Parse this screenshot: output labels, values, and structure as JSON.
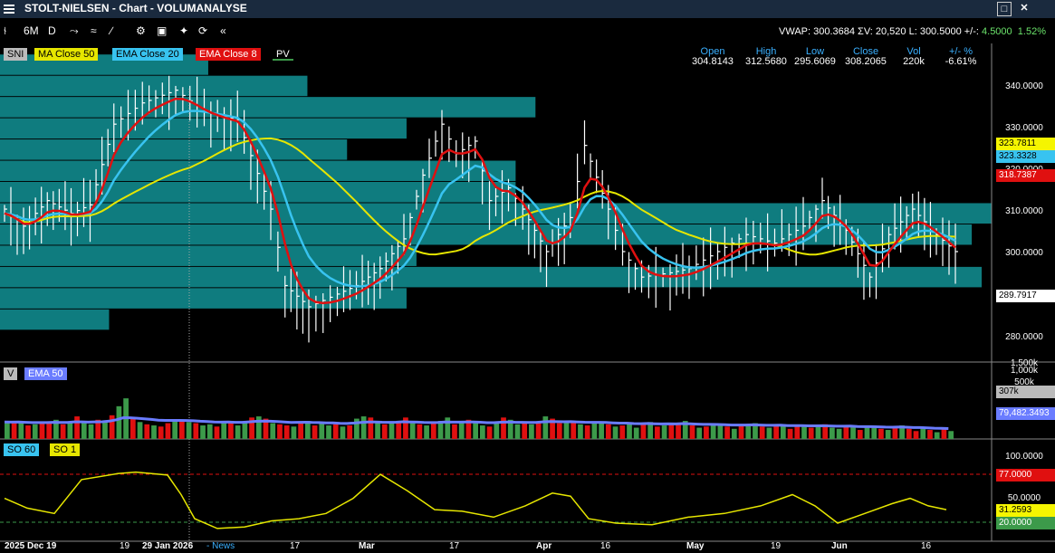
{
  "window": {
    "title": "STOLT-NIELSEN - Chart - VOLUMANALYSE"
  },
  "toolbar": {
    "period": "6M",
    "interval": "D",
    "collapse": "«",
    "vwap_text": "VWAP: 300.3684  ΣV: 20,520  L: 300.5000  +/-: ",
    "change_abs": "4.5000",
    "change_pct": "1.52%"
  },
  "legend": {
    "symbol": "SNI",
    "ma50": "MA Close 50",
    "ema20": "EMA Close 20",
    "ema8": "EMA Close 8",
    "pv": "PV"
  },
  "ohlc": [
    {
      "h": "Open",
      "v": "304.8143"
    },
    {
      "h": "High",
      "v": "312.5680"
    },
    {
      "h": "Low",
      "v": "295.6069"
    },
    {
      "h": "Close",
      "v": "308.2065"
    },
    {
      "h": "Vol",
      "v": "220k"
    },
    {
      "h": "+/- %",
      "v": "-6.61%"
    }
  ],
  "price_axis": {
    "ticks": [
      "340.0000",
      "330.0000",
      "320.0000",
      "310.0000",
      "300.0000",
      "280.0000"
    ],
    "tags": [
      {
        "value": "323.7811",
        "bg": "#f5f500",
        "fg": "#000"
      },
      {
        "value": "323.3328",
        "bg": "#38c3f0",
        "fg": "#000"
      },
      {
        "value": "318.7387",
        "bg": "#e01010",
        "fg": "#fff"
      },
      {
        "value": "289.7917",
        "bg": "#ffffff",
        "fg": "#000"
      }
    ]
  },
  "volume_panel": {
    "label_v": "V",
    "label_ema": "EMA 50",
    "ticks": [
      "1,500k",
      "1,000k",
      "500k"
    ],
    "tag_last": "307k",
    "tag_ema": "79,482.3493"
  },
  "so_panel": {
    "label_60": "SO 60",
    "label_1": "SO 1",
    "ticks": [
      "100.0000",
      "50.0000"
    ],
    "tags": [
      {
        "value": "77.0000",
        "bg": "#e01010",
        "fg": "#fff"
      },
      {
        "value": "31.2593",
        "bg": "#f5f500",
        "fg": "#000"
      },
      {
        "value": "20.0000",
        "bg": "#3c9a4a",
        "fg": "#fff"
      }
    ]
  },
  "x_axis": [
    "2025 Dec 19",
    "19",
    "29 Jan 2026",
    "- News",
    "17",
    "Mar",
    "17",
    "Apr",
    "16",
    "May",
    "19",
    "Jun",
    "16"
  ],
  "colors": {
    "teal": "#0f7c7f",
    "ma50": "#e6e600",
    "ema20": "#38c3f0",
    "ema8": "#e01010",
    "volume_up": "#3c9a4a",
    "volume_down": "#e01010",
    "volume_ema": "#6a7cff",
    "so_upper": "#e01010",
    "so_lower": "#3c9a4a"
  },
  "chart_data": {
    "type": "line",
    "ylim": [
      275,
      350
    ],
    "volume_profile": [
      {
        "price": 345,
        "extent": 0.21
      },
      {
        "price": 340,
        "extent": 0.31
      },
      {
        "price": 335,
        "extent": 0.54
      },
      {
        "price": 330,
        "extent": 0.41
      },
      {
        "price": 325,
        "extent": 0.35
      },
      {
        "price": 320,
        "extent": 0.52
      },
      {
        "price": 315,
        "extent": 0.52
      },
      {
        "price": 310,
        "extent": 1.0
      },
      {
        "price": 305,
        "extent": 0.98
      },
      {
        "price": 300,
        "extent": 0.42
      },
      {
        "price": 295,
        "extent": 0.99
      },
      {
        "price": 290,
        "extent": 0.41
      },
      {
        "price": 285,
        "extent": 0.11
      }
    ],
    "close_series": [
      {
        "d": "2025-12-01",
        "c": 310
      },
      {
        "d": "2025-12-05",
        "c": 306
      },
      {
        "d": "2025-12-10",
        "c": 312
      },
      {
        "d": "2025-12-15",
        "c": 309
      },
      {
        "d": "2025-12-19",
        "c": 311
      },
      {
        "d": "2025-12-24",
        "c": 330
      },
      {
        "d": "2025-12-30",
        "c": 335
      },
      {
        "d": "2026-01-06",
        "c": 338
      },
      {
        "d": "2026-01-12",
        "c": 333
      },
      {
        "d": "2026-01-19",
        "c": 331
      },
      {
        "d": "2026-01-26",
        "c": 310
      },
      {
        "d": "2026-01-29",
        "c": 292
      },
      {
        "d": "2026-02-03",
        "c": 287
      },
      {
        "d": "2026-02-09",
        "c": 290
      },
      {
        "d": "2026-02-13",
        "c": 292
      },
      {
        "d": "2026-02-18",
        "c": 296
      },
      {
        "d": "2026-02-23",
        "c": 303
      },
      {
        "d": "2026-02-27",
        "c": 318
      },
      {
        "d": "2026-03-03",
        "c": 330
      },
      {
        "d": "2026-03-06",
        "c": 323
      },
      {
        "d": "2026-03-10",
        "c": 326
      },
      {
        "d": "2026-03-13",
        "c": 312
      },
      {
        "d": "2026-03-17",
        "c": 315
      },
      {
        "d": "2026-03-20",
        "c": 310
      },
      {
        "d": "2026-03-25",
        "c": 300
      },
      {
        "d": "2026-03-30",
        "c": 308
      },
      {
        "d": "2026-04-02",
        "c": 325
      },
      {
        "d": "2026-04-07",
        "c": 310
      },
      {
        "d": "2026-04-10",
        "c": 300
      },
      {
        "d": "2026-04-14",
        "c": 294
      },
      {
        "d": "2026-04-20",
        "c": 295
      },
      {
        "d": "2026-04-24",
        "c": 296
      },
      {
        "d": "2026-04-30",
        "c": 300
      },
      {
        "d": "2026-05-06",
        "c": 304
      },
      {
        "d": "2026-05-12",
        "c": 302
      },
      {
        "d": "2026-05-18",
        "c": 306
      },
      {
        "d": "2026-05-22",
        "c": 312
      },
      {
        "d": "2026-05-27",
        "c": 305
      },
      {
        "d": "2026-06-01",
        "c": 294
      },
      {
        "d": "2026-06-05",
        "c": 304
      },
      {
        "d": "2026-06-10",
        "c": 310
      },
      {
        "d": "2026-06-15",
        "c": 304
      },
      {
        "d": "2026-06-19",
        "c": 300
      }
    ],
    "volume_k": [
      150,
      140,
      160,
      120,
      130,
      140,
      150,
      170,
      130,
      150,
      200,
      150,
      130,
      170,
      160,
      210,
      290,
      360,
      180,
      150,
      130,
      120,
      110,
      140,
      160,
      170,
      150,
      140,
      120,
      130,
      110,
      140,
      160,
      120,
      150,
      190,
      200,
      180,
      140,
      130,
      120,
      110,
      150,
      160,
      120,
      140,
      120,
      130,
      110,
      120,
      180,
      200,
      190,
      150,
      130,
      140,
      150,
      190,
      140,
      130,
      120,
      140,
      160,
      190,
      130,
      150,
      170,
      150,
      120,
      110,
      140,
      190,
      170,
      130,
      140,
      130,
      150,
      200,
      180,
      140,
      150,
      160,
      130,
      120,
      140,
      150,
      130,
      110,
      120,
      140,
      100,
      130,
      150,
      110,
      120,
      140,
      130,
      160,
      120,
      100,
      110,
      130,
      120,
      110,
      90,
      130,
      120,
      140,
      110,
      100,
      120,
      130,
      90,
      110,
      120,
      100,
      110,
      130,
      100,
      90,
      110,
      120,
      80,
      100,
      110,
      90,
      80,
      100,
      120,
      90,
      70,
      100,
      80,
      60,
      90,
      70
    ]
  }
}
